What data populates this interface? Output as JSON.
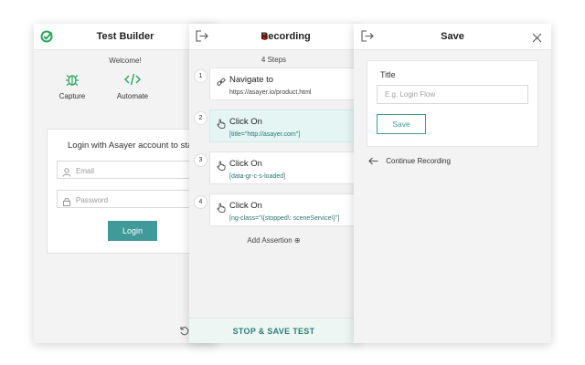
{
  "panel1": {
    "title": "Test Builder",
    "welcome": "Welcome!",
    "features": [
      {
        "label": "Capture",
        "icon": "bug-icon"
      },
      {
        "label": "Automate",
        "icon": "code-icon"
      }
    ],
    "login": {
      "title": "Login with Asayer account to sta",
      "email_placeholder": "Email",
      "password_placeholder": "Password",
      "button": "Login"
    }
  },
  "panel2": {
    "title": "Recording",
    "steps_count": "4 Steps",
    "steps": [
      {
        "num": "1",
        "title": "Navigate to",
        "detail": "https://asayer.io/product.html",
        "icon": "link-icon"
      },
      {
        "num": "2",
        "title": "Click On",
        "detail": "[title=\"http://asayer.com\"]",
        "icon": "hand-pointer-icon"
      },
      {
        "num": "3",
        "title": "Click On",
        "detail": "[data-gr-c-s-loaded]",
        "icon": "hand-pointer-icon"
      },
      {
        "num": "4",
        "title": "Click On",
        "detail": "[ng-class=\"\\{stopped\\: sceneService\\}\"]",
        "icon": "hand-pointer-icon"
      }
    ],
    "add_assertion": "Add Assertion ⊕",
    "stop_button": "STOP & SAVE TEST"
  },
  "panel3": {
    "title": "Save",
    "field_label": "Title",
    "field_placeholder": "E.g. Login Flow",
    "save_button": "Save",
    "continue_label": "Continue Recording"
  },
  "colors": {
    "accent": "#3f9a99",
    "record_dot": "#c71818",
    "active_step_bg": "#e5f5f3",
    "logo_green": "#2aa55a"
  }
}
